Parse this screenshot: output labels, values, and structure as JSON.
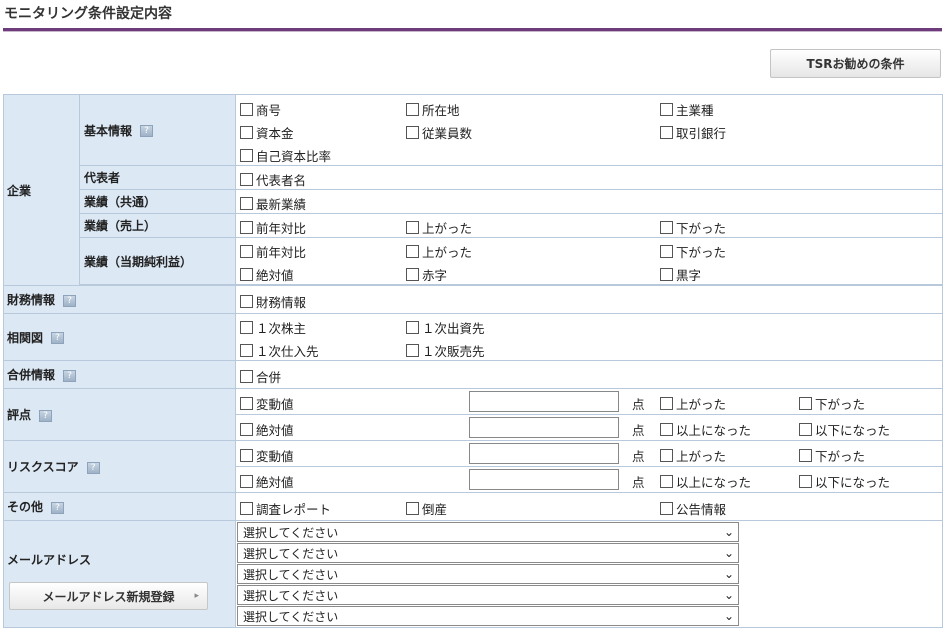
{
  "header": {
    "title": "モニタリング条件設定内容",
    "tsr_button": "TSRお勧めの条件"
  },
  "hint_icon": "help-icon",
  "company": {
    "label": "企業",
    "basic": {
      "label": "基本情報",
      "items": [
        "商号",
        "所在地",
        "主業種",
        "資本金",
        "従業員数",
        "取引銀行",
        "自己資本比率"
      ]
    },
    "rep": {
      "label": "代表者",
      "items": [
        "代表者名"
      ]
    },
    "perf_common": {
      "label": "業績（共通）",
      "items": [
        "最新業績"
      ]
    },
    "perf_sales": {
      "label": "業績（売上）",
      "items": [
        "前年対比",
        "上がった",
        "下がった"
      ]
    },
    "perf_profit": {
      "label": "業績（当期純利益）",
      "items": [
        "前年対比",
        "上がった",
        "下がった",
        "絶対値",
        "赤字",
        "黒字"
      ]
    }
  },
  "finance": {
    "label": "財務情報",
    "items": [
      "財務情報"
    ]
  },
  "relation": {
    "label": "相関図",
    "items": [
      "１次株主",
      "１次出資先",
      "１次仕入先",
      "１次販売先"
    ]
  },
  "merger": {
    "label": "合併情報",
    "items": [
      "合併"
    ]
  },
  "score": {
    "label": "評点",
    "unit": "点",
    "row1": [
      "変動値",
      "上がった",
      "下がった"
    ],
    "row2": [
      "絶対値",
      "以上になった",
      "以下になった"
    ]
  },
  "risk": {
    "label": "リスクスコア",
    "unit": "点",
    "row1": [
      "変動値",
      "上がった",
      "下がった"
    ],
    "row2": [
      "絶対値",
      "以上になった",
      "以下になった"
    ]
  },
  "other": {
    "label": "その他",
    "items": [
      "調査レポート",
      "倒産",
      "公告情報"
    ]
  },
  "mail": {
    "label": "メールアドレス",
    "register_button": "メールアドレス新規登録",
    "selects": [
      "選択してください",
      "選択してください",
      "選択してください",
      "選択してください",
      "選択してください"
    ]
  },
  "colors": {
    "accent": "#6e3b7b",
    "label_bg": "#dce8f4",
    "border": "#b8c9dc"
  }
}
